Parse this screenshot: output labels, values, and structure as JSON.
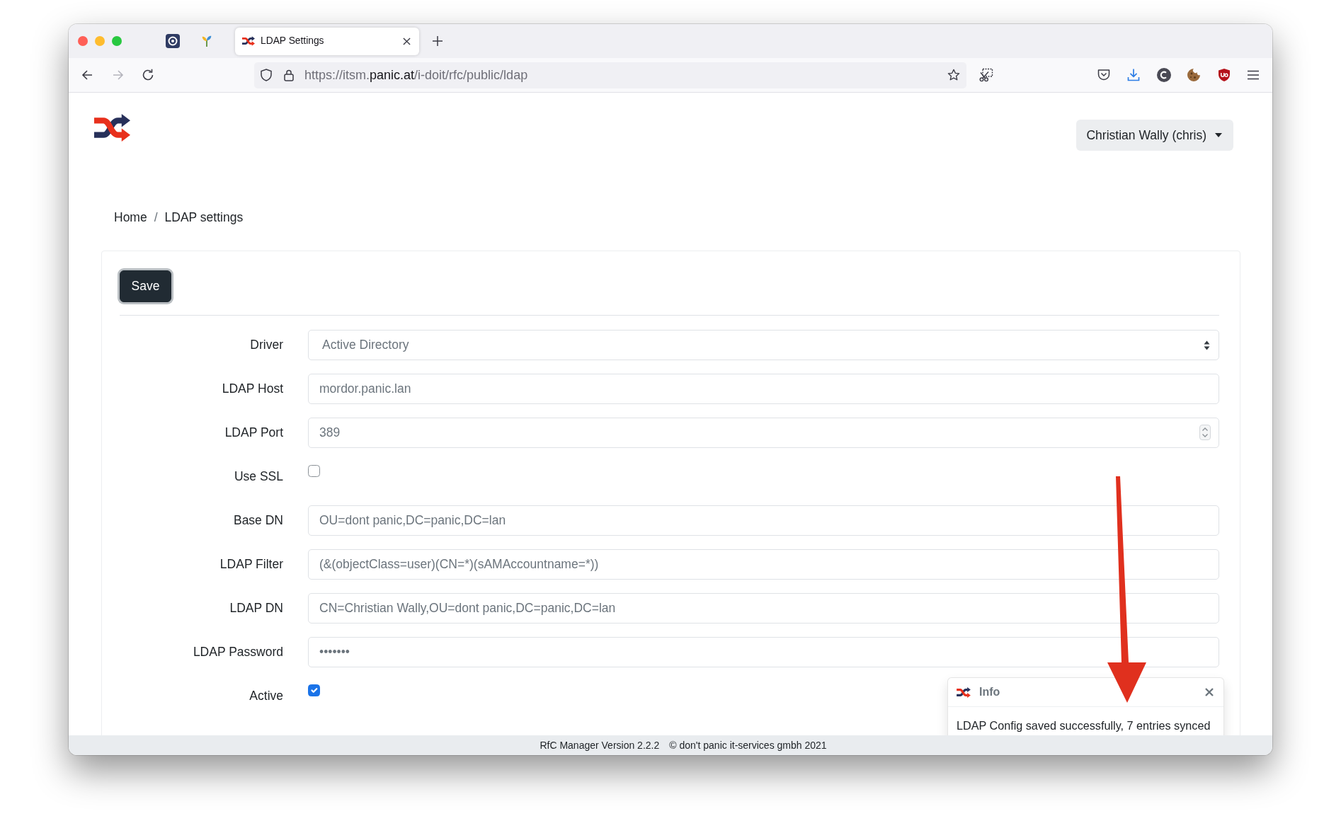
{
  "browser": {
    "tabs": [
      {
        "kind": "pinned",
        "selected": false
      },
      {
        "kind": "pinned",
        "selected": false
      },
      {
        "kind": "page",
        "title": "LDAP Settings",
        "selected": true
      }
    ],
    "address": {
      "prefix": "https://itsm.",
      "domain": "panic.at",
      "path": "/i-doit/rfc/public/ldap"
    }
  },
  "header": {
    "user_menu": "Christian Wally (chris)"
  },
  "breadcrumb": [
    {
      "kind": "link",
      "label": "Home"
    },
    {
      "kind": "separator",
      "label": "/"
    },
    {
      "kind": "current",
      "label": "LDAP settings"
    }
  ],
  "toolbar": {
    "save_button": "Save"
  },
  "form": {
    "fields": [
      {
        "kind": "select",
        "label": "Driver",
        "value": "Active Directory"
      },
      {
        "kind": "text",
        "label": "LDAP Host",
        "value": "mordor.panic.lan"
      },
      {
        "kind": "number",
        "label": "LDAP Port",
        "value": "389"
      },
      {
        "kind": "checkbox",
        "label": "Use SSL",
        "checked": false
      },
      {
        "kind": "text",
        "label": "Base DN",
        "value": "OU=dont panic,DC=panic,DC=lan"
      },
      {
        "kind": "text",
        "label": "LDAP Filter",
        "value": "(&(objectClass=user)(CN=*)(sAMAccountname=*))"
      },
      {
        "kind": "text",
        "label": "LDAP DN",
        "value": "CN=Christian Wally,OU=dont panic,DC=panic,DC=lan"
      },
      {
        "kind": "password",
        "label": "LDAP Password",
        "value": "•••••••"
      },
      {
        "kind": "checkbox",
        "label": "Active",
        "checked": true
      }
    ]
  },
  "toast": {
    "title": "Info",
    "message": "LDAP Config saved successfully, 7 entries synced"
  },
  "footer": {
    "version": "RfC Manager Version 2.2.2",
    "copyright": "© don't panic it-services gmbh 2021"
  }
}
